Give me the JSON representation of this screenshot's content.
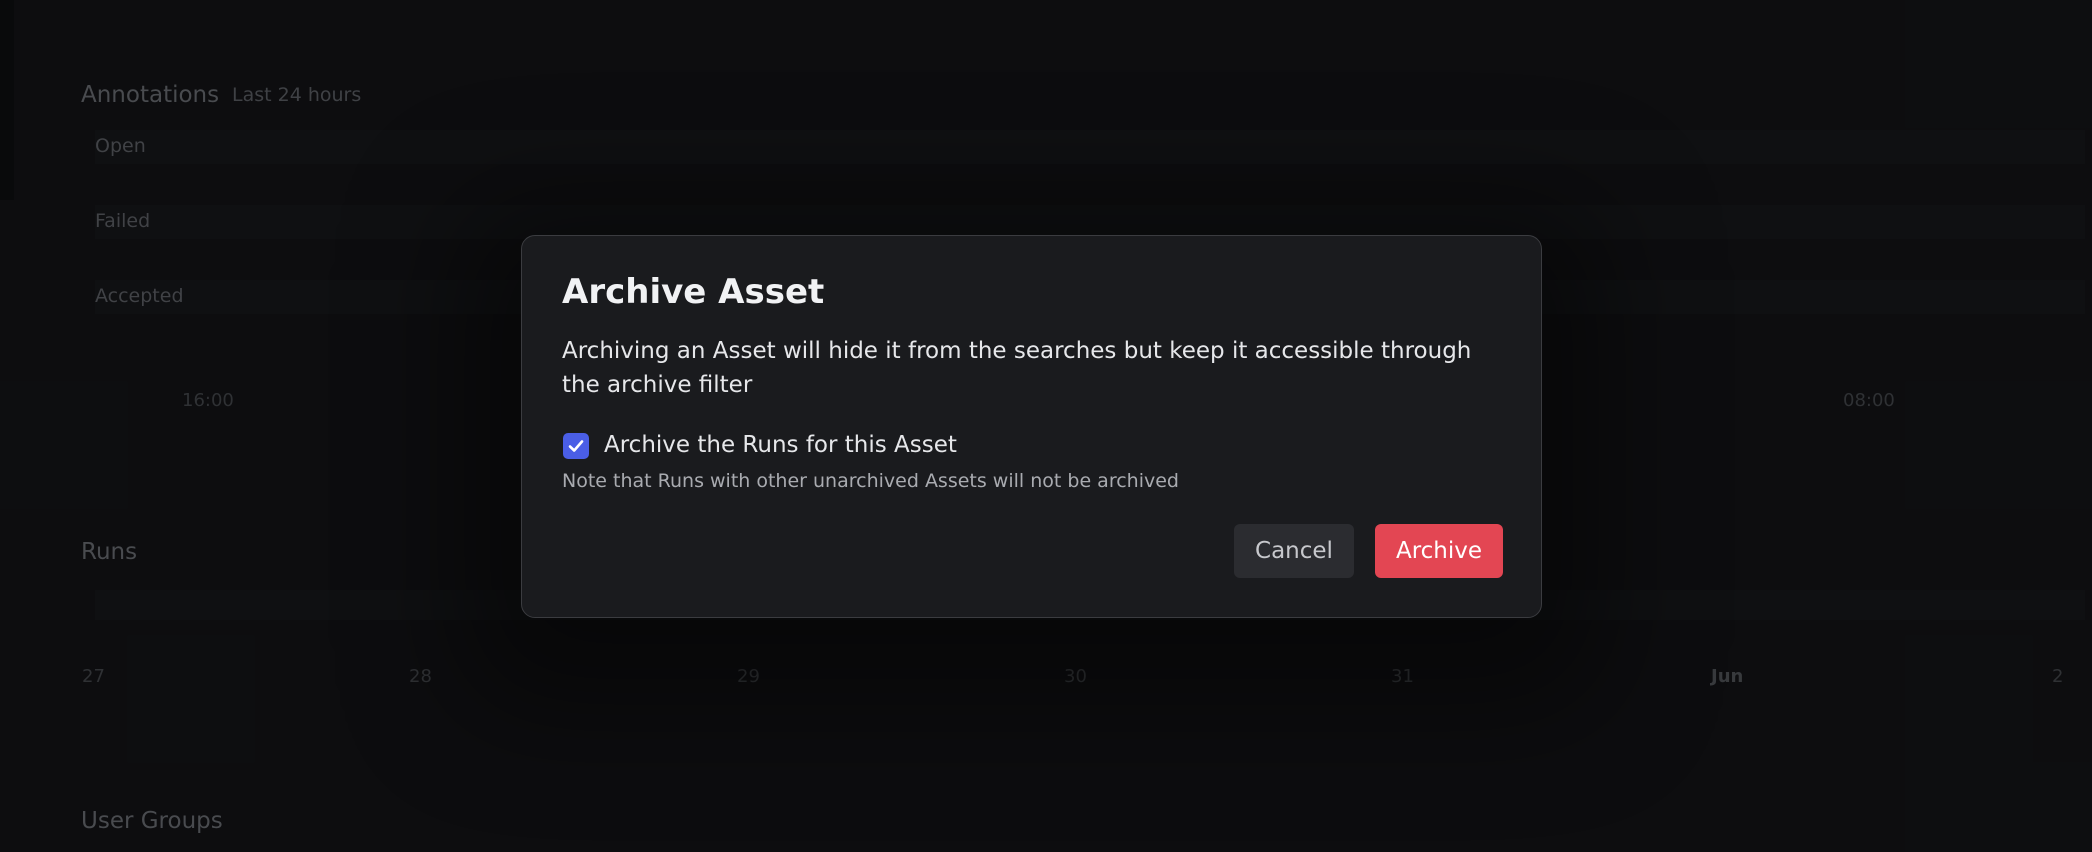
{
  "background": {
    "annotations": {
      "title": "Annotations",
      "subtitle": "Last 24 hours",
      "rows": [
        "Open",
        "Failed",
        "Accepted"
      ],
      "time_ticks": [
        "16:00",
        "08:00"
      ]
    },
    "runs": {
      "title": "Runs",
      "date_ticks": [
        "27",
        "28",
        "29",
        "30",
        "31",
        "Jun",
        "2"
      ]
    },
    "user_groups": {
      "title": "User Groups"
    }
  },
  "modal": {
    "title": "Archive Asset",
    "body": "Archiving an Asset will hide it from the searches but keep it accessible through the archive filter",
    "checkbox": {
      "label": "Archive the Runs for this Asset",
      "checked": true,
      "note": "Note that Runs with other unarchived Assets will not be archived"
    },
    "buttons": {
      "cancel": "Cancel",
      "archive": "Archive"
    }
  },
  "colors": {
    "primary_accent": "#4a5ee6",
    "danger": "#e34653",
    "modal_bg": "#1a1b1e",
    "page_bg": "#101113"
  }
}
